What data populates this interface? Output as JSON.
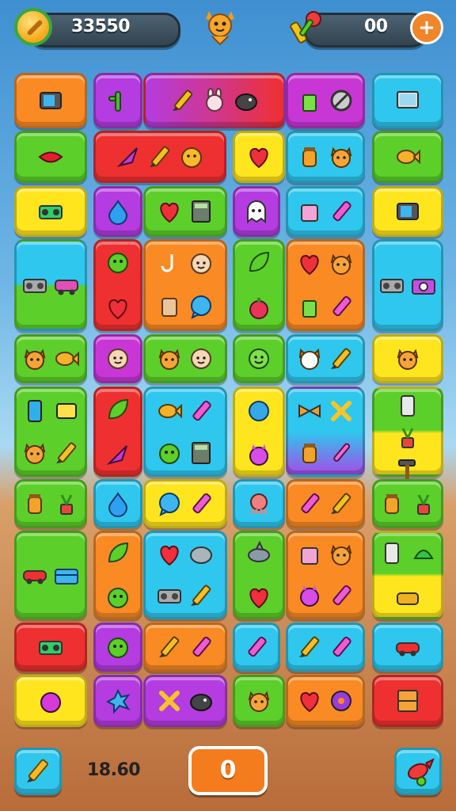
{
  "hud": {
    "coins": "33550",
    "keys": "00",
    "add_label": "+"
  },
  "footer": {
    "timer": "18.60",
    "counter": "0"
  },
  "colors": {
    "orange": "#f98a24",
    "purple": "#b43ce0",
    "cyan": "#2fc7ee",
    "green": "#5ccf2a",
    "red": "#ef3030",
    "yellow": "#ffe51e"
  },
  "board": {
    "tiles": [
      {
        "color": "orange",
        "icons": [
          "tv-icon"
        ]
      },
      {
        "color": "purple",
        "icons": [
          "cactus-icon"
        ]
      },
      {
        "color": "purple-red",
        "icons": [
          "pencil-icon",
          "bunny-icon",
          "bomb-icon"
        ]
      },
      {
        "color": "magenta",
        "icons": [
          "cup-icon",
          "no-sign-icon"
        ]
      },
      {
        "color": "cyan",
        "icons": [
          "monitor-icon"
        ]
      },
      {
        "color": "green",
        "icons": [
          "lips-icon"
        ]
      },
      {
        "color": "red",
        "icons": [
          "feather-icon",
          "pencil-icon",
          "chick-icon"
        ]
      },
      {
        "color": "yellow",
        "icons": [
          "heart-icon"
        ]
      },
      {
        "color": "cyan",
        "icons": [
          "jar-icon",
          "cat-icon"
        ]
      },
      {
        "color": "green",
        "icons": [
          "fish-icon"
        ]
      },
      {
        "color": "yellow",
        "icons": [
          "boombox-icon"
        ]
      },
      {
        "color": "purple",
        "icons": [
          "drop-icon"
        ]
      },
      {
        "color": "green",
        "icons": [
          "heart-icon",
          "calculator-icon"
        ]
      },
      {
        "color": "purple",
        "icons": [
          "ghost-icon"
        ]
      },
      {
        "color": "cyan",
        "icons": [
          "box-icon",
          "crayon-icon"
        ]
      },
      {
        "color": "yellow",
        "icons": [
          "tv-icon"
        ]
      },
      {
        "color": "cyan-green",
        "icons": [
          "radio-icon",
          "van-icon"
        ]
      },
      {
        "color": "red",
        "icons": [
          "frog-icon",
          "heart-icon"
        ]
      },
      {
        "color": "orange",
        "icons": [
          "hook-icon",
          "face-icon",
          "scroll-icon",
          "chat-icon"
        ]
      },
      {
        "color": "green",
        "icons": [
          "leaf-icon",
          "berry-icon"
        ]
      },
      {
        "color": "orange",
        "icons": [
          "heart-icon",
          "cat-icon",
          "cup-icon",
          "crayon-icon"
        ]
      },
      {
        "color": "cyan",
        "icons": [
          "radio-icon",
          "camera-icon"
        ]
      },
      {
        "color": "green",
        "icons": [
          "cat-icon",
          "fish-icon"
        ]
      },
      {
        "color": "magenta",
        "icons": [
          "face-icon"
        ]
      },
      {
        "color": "green",
        "icons": [
          "cat-icon",
          "face-icon"
        ]
      },
      {
        "color": "green",
        "icons": [
          "smile-icon"
        ]
      },
      {
        "color": "cyan",
        "icons": [
          "fox-icon",
          "pencil-icon"
        ]
      },
      {
        "color": "yellow",
        "icons": [
          "cat-icon"
        ]
      },
      {
        "color": "green",
        "icons": [
          "phone-icon",
          "note-icon",
          "cat-icon",
          "pencil-icon"
        ]
      },
      {
        "color": "red",
        "icons": [
          "leaf-icon",
          "feather-icon"
        ]
      },
      {
        "color": "cyan",
        "icons": [
          "fish-icon",
          "crayon-icon",
          "frog-icon",
          "calculator-icon"
        ]
      },
      {
        "color": "yellow",
        "icons": [
          "blob-icon",
          "devil-icon"
        ]
      },
      {
        "color": "cyan-purple",
        "icons": [
          "bow-icon",
          "x-icon",
          "jar-icon",
          "brush-icon"
        ]
      },
      {
        "color": "green-yellow",
        "icons": [
          "can-icon",
          "plant-icon",
          "hammer-icon",
          "virus-icon"
        ]
      },
      {
        "color": "green",
        "icons": [
          "jar-icon",
          "plant-icon"
        ]
      },
      {
        "color": "cyan",
        "icons": [
          "drop-icon"
        ]
      },
      {
        "color": "yellow",
        "icons": [
          "chat-icon",
          "crayon-icon"
        ]
      },
      {
        "color": "cyan",
        "icons": [
          "octopus-icon"
        ]
      },
      {
        "color": "orange",
        "icons": [
          "crayon-icon",
          "pencil-icon"
        ]
      },
      {
        "color": "green",
        "icons": [
          "jar-icon",
          "plant-icon"
        ]
      },
      {
        "color": "green",
        "icons": [
          "car-icon",
          "chest-icon"
        ]
      },
      {
        "color": "orange",
        "icons": [
          "leaf-icon",
          "frog-icon"
        ]
      },
      {
        "color": "cyan",
        "icons": [
          "heart-icon",
          "seal-icon",
          "radio-icon",
          "pencil-icon"
        ]
      },
      {
        "color": "green",
        "icons": [
          "shark-icon",
          "heart-icon"
        ]
      },
      {
        "color": "orange",
        "icons": [
          "box-icon",
          "cat-icon",
          "devil-icon",
          "crayon-icon"
        ]
      },
      {
        "color": "green-yellow",
        "icons": [
          "can-icon",
          "hat-icon",
          "vacuum-icon"
        ]
      },
      {
        "color": "red",
        "icons": [
          "boombox-icon"
        ]
      },
      {
        "color": "purple",
        "icons": [
          "frog-icon"
        ]
      },
      {
        "color": "orange",
        "icons": [
          "pencil-icon",
          "crayon-icon"
        ]
      },
      {
        "color": "cyan",
        "icons": [
          "crayon-icon"
        ]
      },
      {
        "color": "cyan",
        "icons": [
          "pencil-icon",
          "crayon-icon"
        ]
      },
      {
        "color": "cyan",
        "icons": [
          "car-icon"
        ]
      },
      {
        "color": "yellow",
        "icons": [
          "apple-icon"
        ]
      },
      {
        "color": "purple",
        "icons": [
          "splat-icon"
        ]
      },
      {
        "color": "purple",
        "icons": [
          "x-icon",
          "bomb-icon"
        ]
      },
      {
        "color": "green",
        "icons": [
          "cat-icon"
        ]
      },
      {
        "color": "orange",
        "icons": [
          "heart-icon",
          "donut-icon"
        ]
      },
      {
        "color": "red",
        "icons": [
          "shelf-icon"
        ]
      }
    ]
  },
  "buttons": {
    "left_icon": "pencil-icon",
    "right_icon": "bird-icon"
  }
}
